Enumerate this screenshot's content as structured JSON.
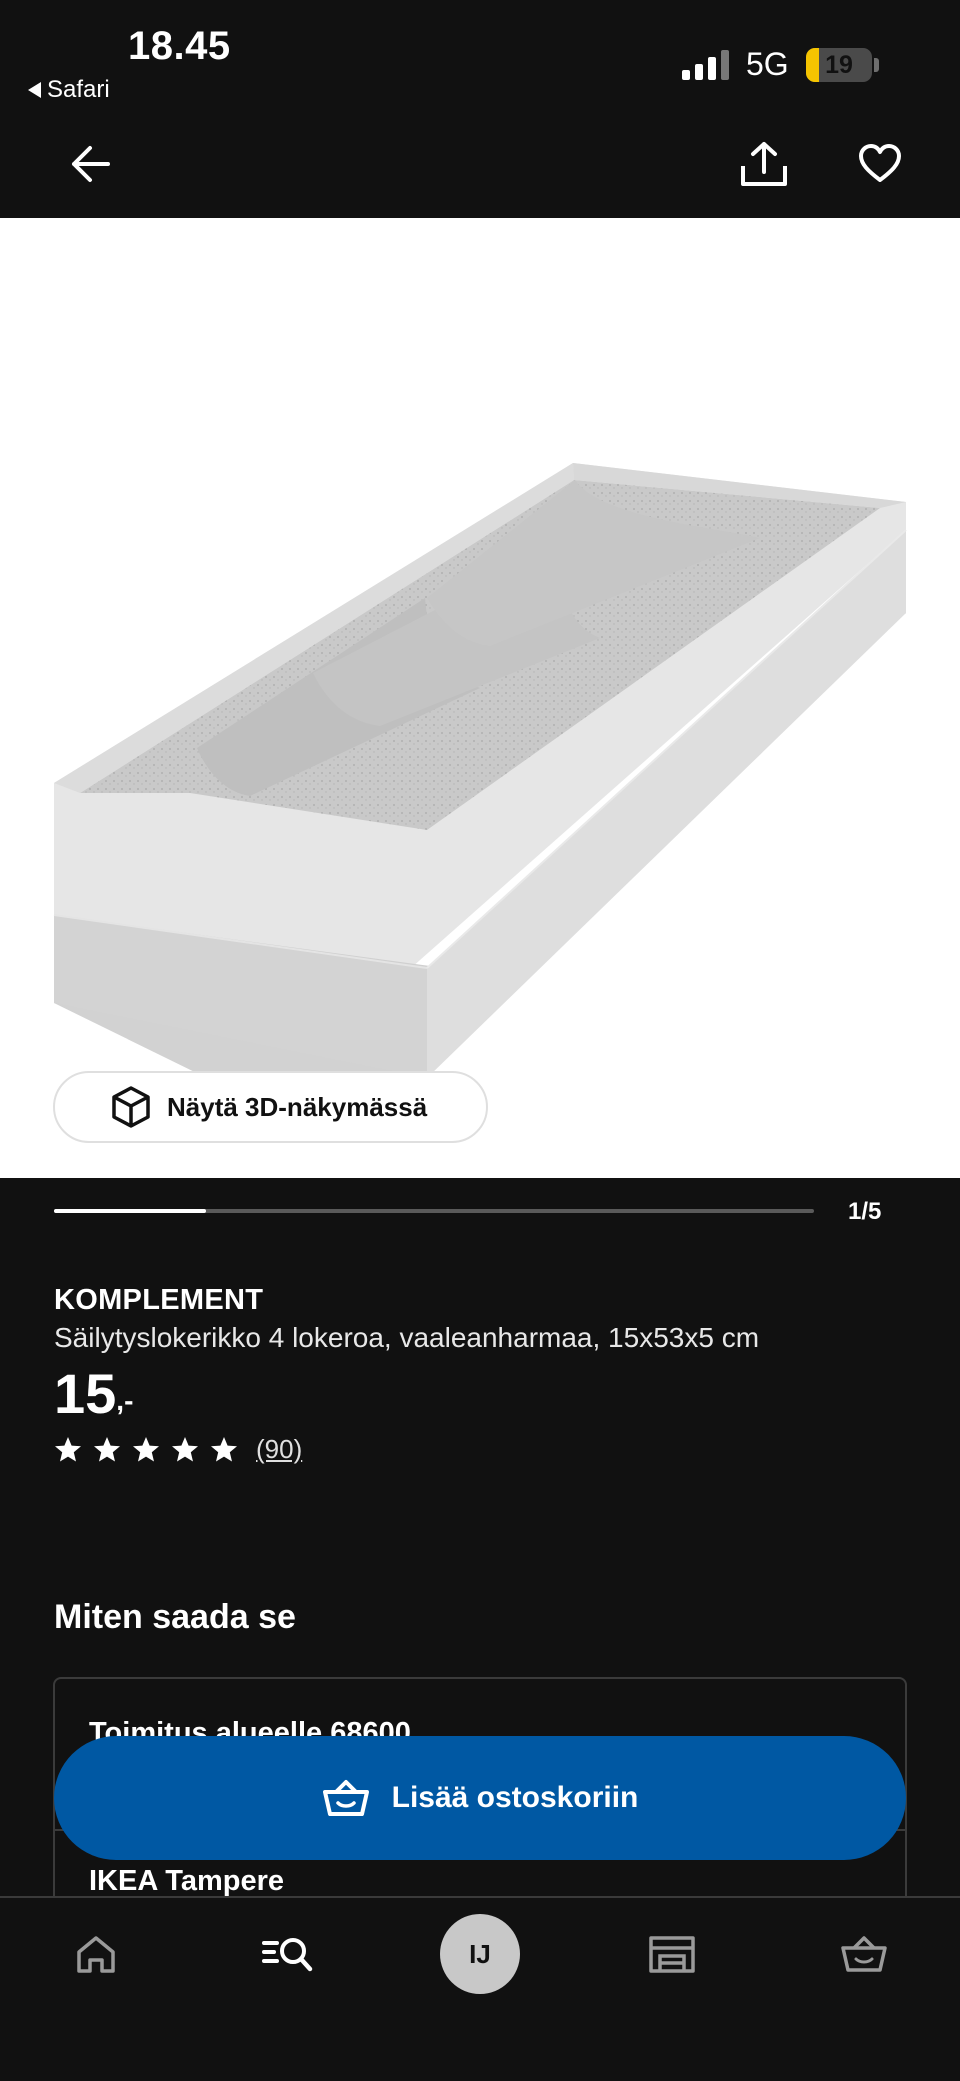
{
  "status_bar": {
    "time": "18.45",
    "back_app": "Safari",
    "network": "5G",
    "battery": "19",
    "battery_level_percent": 19
  },
  "top_nav": {
    "back_icon": "arrow-left-icon",
    "share_icon": "share-icon",
    "favorite_icon": "heart-icon"
  },
  "gallery": {
    "button_3d_label": "Näytä 3D-näkymässä",
    "button_3d_icon": "cube-icon",
    "counter": "1/5",
    "progress_fraction": 0.2
  },
  "product": {
    "brand": "KOMPLEMENT",
    "description": "Säilytyslokerikko 4 lokeroa, vaaleanharmaa, 15x53x5 cm",
    "price_integer": "15",
    "price_decimal": ",-",
    "rating_stars": 5,
    "rating_count": "(90)"
  },
  "availability": {
    "title": "Miten saada se",
    "delivery_label": "Toimitus alueelle 68600",
    "store_label": "IKEA Tampere"
  },
  "cta": {
    "add_to_cart_label": "Lisää ostoskoriin",
    "icon": "basket-icon",
    "color": "#0058a3"
  },
  "tab_bar": {
    "home_icon": "home-icon",
    "search_icon": "search-icon",
    "profile_initials": "IJ",
    "stores_icon": "store-icon",
    "cart_icon": "basket-icon"
  }
}
